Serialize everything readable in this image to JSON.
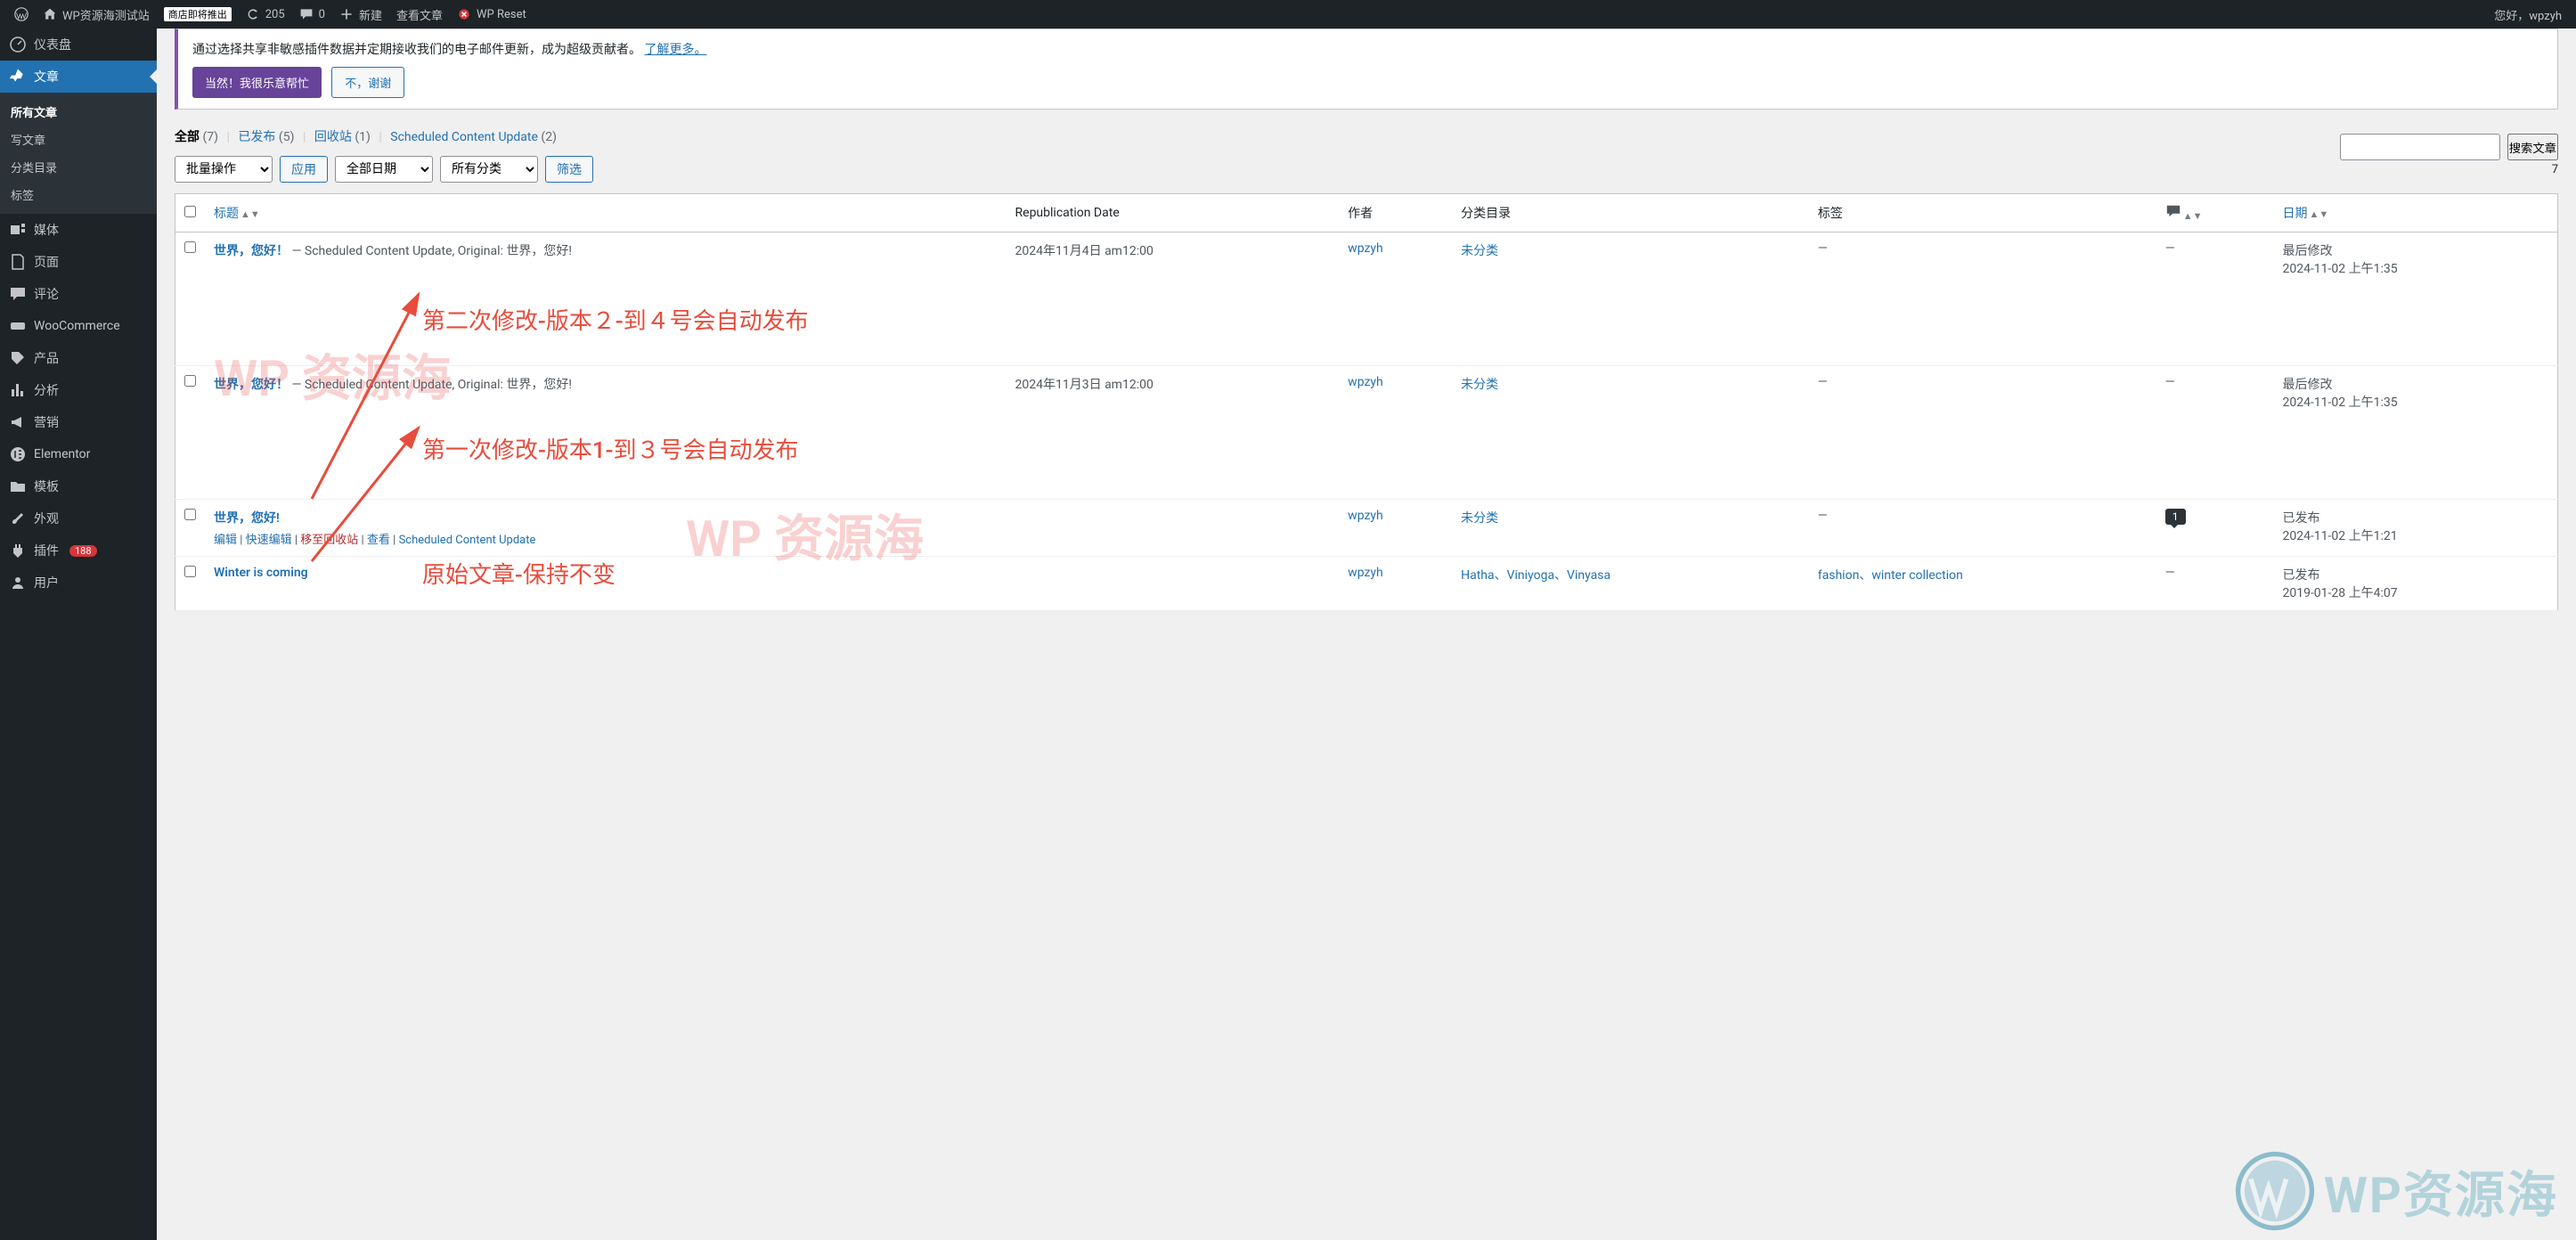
{
  "adminbar": {
    "site_name": "WP资源海测试站",
    "store_badge": "商店即将推出",
    "updates": "205",
    "comments": "0",
    "new": "新建",
    "view_post": "查看文章",
    "wp_reset": "WP Reset",
    "howdy": "您好，wpzyh"
  },
  "sidebar": {
    "items": [
      {
        "id": "dashboard",
        "label": "仪表盘"
      },
      {
        "id": "posts",
        "label": "文章"
      },
      {
        "id": "media",
        "label": "媒体"
      },
      {
        "id": "pages",
        "label": "页面"
      },
      {
        "id": "comments",
        "label": "评论"
      },
      {
        "id": "woocommerce",
        "label": "WooCommerce"
      },
      {
        "id": "products",
        "label": "产品"
      },
      {
        "id": "analytics",
        "label": "分析"
      },
      {
        "id": "marketing",
        "label": "营销"
      },
      {
        "id": "elementor",
        "label": "Elementor"
      },
      {
        "id": "templates",
        "label": "模板"
      },
      {
        "id": "appearance",
        "label": "外观"
      },
      {
        "id": "plugins",
        "label": "插件"
      },
      {
        "id": "users",
        "label": "用户"
      }
    ],
    "plugin_badge": "188",
    "submenu_posts": [
      "所有文章",
      "写文章",
      "分类目录",
      "标签"
    ]
  },
  "notice": {
    "text": "通过选择共享非敏感插件数据并定期接收我们的电子邮件更新，成为超级贡献者。",
    "link": "了解更多。",
    "btn_yes": "当然！我很乐意帮忙",
    "btn_no": "不，谢谢"
  },
  "filters": {
    "all": "全部",
    "all_count": "(7)",
    "published": "已发布",
    "published_count": "(5)",
    "trash": "回收站",
    "trash_count": "(1)",
    "scheduled": "Scheduled Content Update",
    "scheduled_count": "(2)"
  },
  "search": {
    "placeholder": "",
    "button": "搜索文章"
  },
  "bulk": {
    "action": "批量操作",
    "apply": "应用",
    "dates": "全部日期",
    "cats": "所有分类",
    "filter": "筛选",
    "item_count": "7"
  },
  "columns": {
    "title": "标题",
    "repub": "Republication Date",
    "author": "作者",
    "cats": "分类目录",
    "tags": "标签",
    "date": "日期"
  },
  "rows": [
    {
      "title": "世界，您好！",
      "suffix": " — Scheduled Content Update, Original: 世界，您好!",
      "repub": "2024年11月4日 am12:00",
      "author": "wpzyh",
      "cats": "未分类",
      "tags": "—",
      "comments": "—",
      "date_status": "最后修改",
      "date_val": "2024-11-02 上午1:35"
    },
    {
      "title": "世界，您好！",
      "suffix": " — Scheduled Content Update, Original: 世界，您好!",
      "repub": "2024年11月3日 am12:00",
      "author": "wpzyh",
      "cats": "未分类",
      "tags": "—",
      "comments": "—",
      "date_status": "最后修改",
      "date_val": "2024-11-02 上午1:35"
    },
    {
      "title": "世界，您好!",
      "suffix": "",
      "repub": "",
      "author": "wpzyh",
      "cats": "未分类",
      "tags": "—",
      "comments": "1",
      "date_status": "已发布",
      "date_val": "2024-11-02 上午1:21",
      "actions": {
        "edit": "编辑",
        "quick": "快速编辑",
        "trash": "移至回收站",
        "view": "查看",
        "scu": "Scheduled Content Update"
      }
    },
    {
      "title": "Winter is coming",
      "suffix": "",
      "repub": "",
      "author": "wpzyh",
      "cats": "Hatha、Viniyoga、Vinyasa",
      "tags": "fashion、winter collection",
      "comments": "—",
      "date_status": "已发布",
      "date_val": "2019-01-28 上午4:07"
    }
  ],
  "annotations": {
    "a1": "第二次修改-版本２-到４号会自动发布",
    "a2": "第一次修改-版本1-到３号会自动发布",
    "a3": "原始文章-保持不变",
    "wm": "WP 资源海",
    "logo": "WP资源海"
  }
}
